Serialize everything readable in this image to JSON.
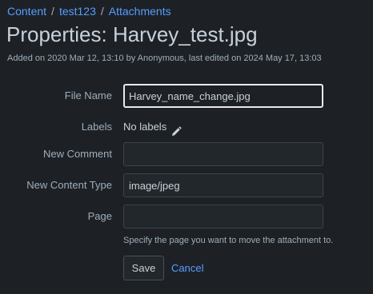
{
  "breadcrumb": {
    "items": [
      "Content",
      "test123",
      "Attachments"
    ],
    "separator": "/"
  },
  "page": {
    "title": "Properties: Harvey_test.jpg",
    "meta": "Added on 2020 Mar 12, 13:10 by Anonymous, last edited on 2024 May 17, 13:03"
  },
  "form": {
    "file_name": {
      "label": "File Name",
      "value": "Harvey_name_change.jpg"
    },
    "labels": {
      "label": "Labels",
      "value": "No labels",
      "edit_icon": "pencil-icon"
    },
    "new_comment": {
      "label": "New Comment",
      "value": ""
    },
    "content_type": {
      "label": "New Content Type",
      "value": "image/jpeg"
    },
    "page": {
      "label": "Page",
      "value": ""
    },
    "help_text": "Specify the page you want to move the attachment to.",
    "save_label": "Save",
    "cancel_label": "Cancel"
  },
  "colors": {
    "background": "#1d2125",
    "link": "#579dff",
    "text": "#c7d1db",
    "muted": "#9fadbc",
    "input_bg": "#22272b"
  }
}
